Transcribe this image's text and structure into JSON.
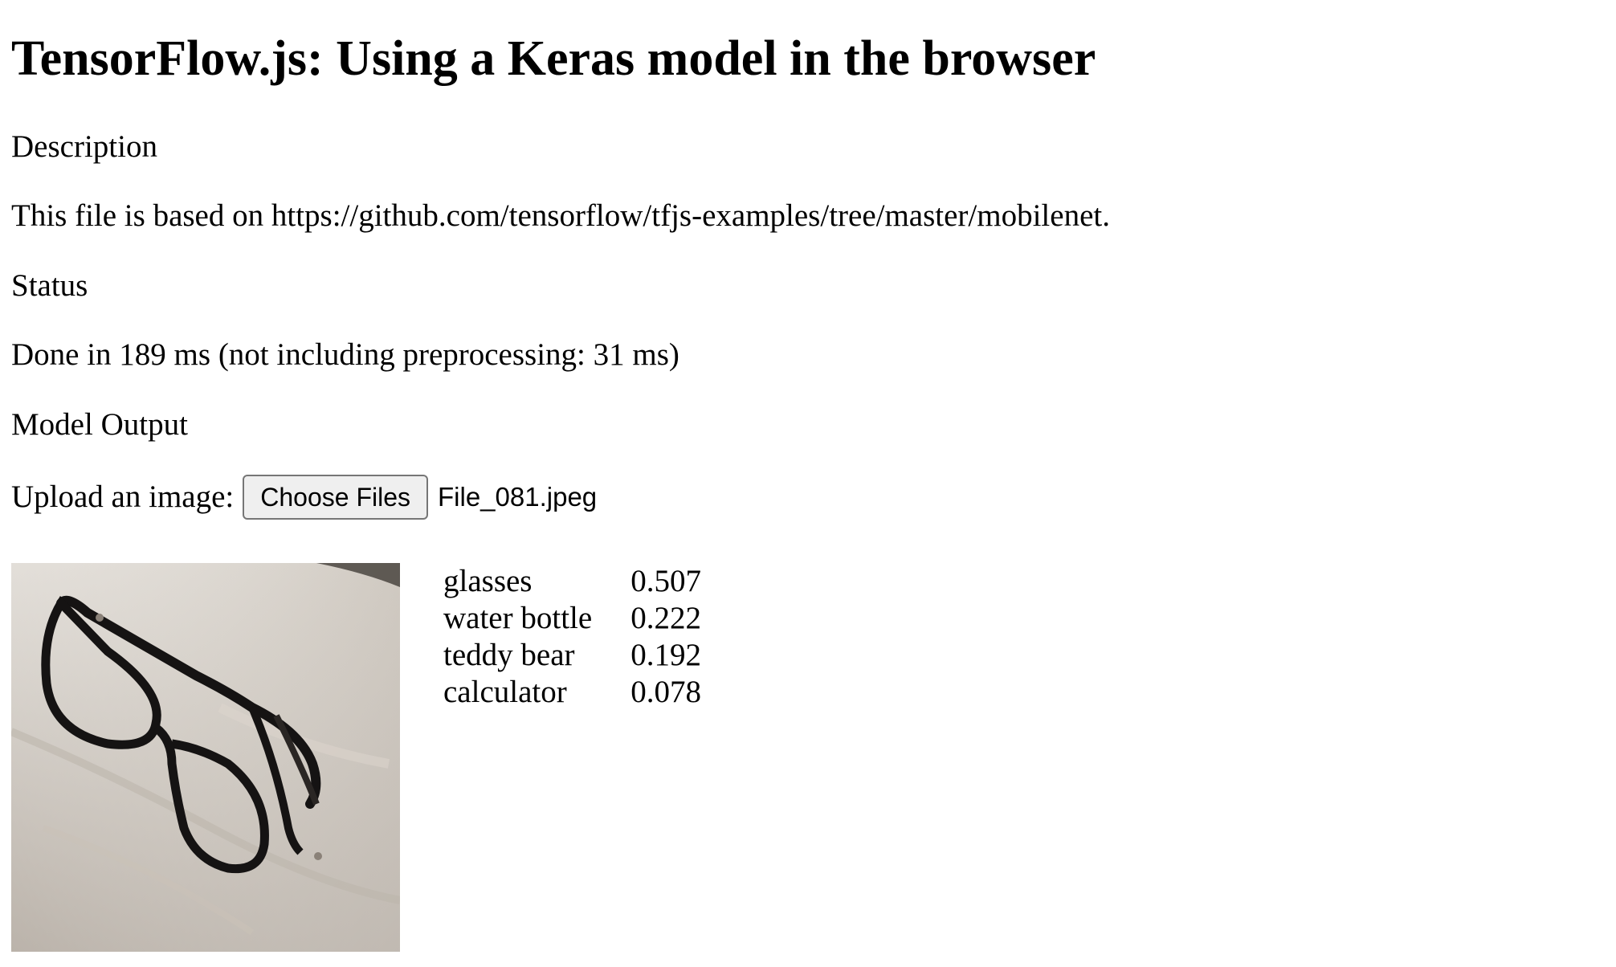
{
  "page": {
    "title": "TensorFlow.js: Using a Keras model in the browser"
  },
  "description": {
    "label": "Description",
    "text": "This file is based on https://github.com/tensorflow/tfjs-examples/tree/master/mobilenet."
  },
  "status": {
    "label": "Status",
    "text": "Done in 189 ms (not including preprocessing: 31 ms)"
  },
  "output": {
    "label": "Model Output"
  },
  "upload": {
    "label": "Upload an image:",
    "button_label": "Choose Files",
    "file_name": "File_081.jpeg"
  },
  "predictions": [
    {
      "label": "glasses",
      "score": "0.507"
    },
    {
      "label": "water bottle",
      "score": "0.222"
    },
    {
      "label": "teddy bear",
      "score": "0.192"
    },
    {
      "label": "calculator",
      "score": "0.078"
    }
  ],
  "colors": {
    "button_bg": "#efefef",
    "button_border": "#767676"
  }
}
